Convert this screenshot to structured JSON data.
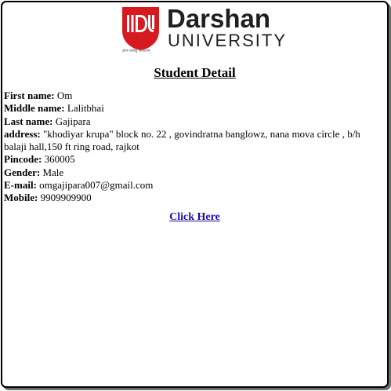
{
  "logo": {
    "icon": "darshan-university-logo-mark",
    "name": "Darshan",
    "subtitle": "UNIVERSITY",
    "tagline": "ज्ञान-कर्मसु कौशलम्",
    "brand_color": "#d71920"
  },
  "page": {
    "title": "Student Detail"
  },
  "fields": [
    {
      "label": "First name:",
      "value": "Om"
    },
    {
      "label": "Middle name:",
      "value": "Lalitbhai"
    },
    {
      "label": "Last name:",
      "value": "Gajipara"
    },
    {
      "label": "address:",
      "value": "\"khodiyar krupa\" block no. 22 , govindratna banglowz, nana mova circle , b/h balaji hall,150 ft ring road, rajkot"
    },
    {
      "label": "Pincode:",
      "value": "360005"
    },
    {
      "label": "Gender:",
      "value": "Male"
    },
    {
      "label": "E-mail:",
      "value": "omgajipara007@gmail.com"
    },
    {
      "label": "Mobile:",
      "value": "9909909900"
    }
  ],
  "link": {
    "label": "Click Here",
    "color": "#1a0dab"
  }
}
